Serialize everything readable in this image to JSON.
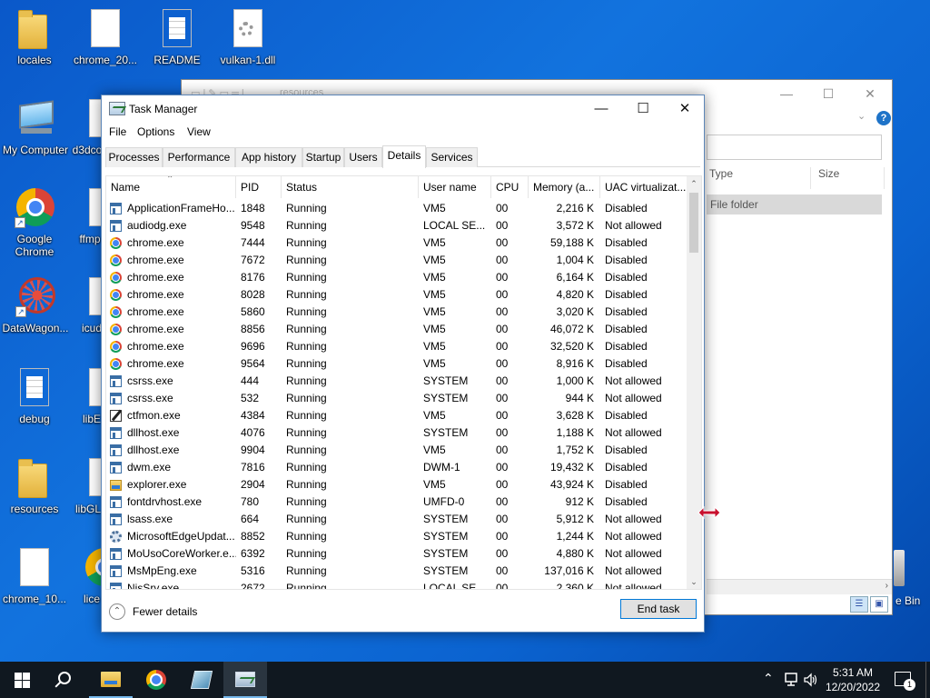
{
  "desktop": {
    "icons": [
      {
        "label": "locales",
        "icon": "folder-icon"
      },
      {
        "label": "chrome_20...",
        "icon": "file-icon"
      },
      {
        "label": "README",
        "icon": "text-file-icon"
      },
      {
        "label": "vulkan-1.dll",
        "icon": "dll-file-icon"
      },
      {
        "label": "My Computer",
        "icon": "computer-icon"
      },
      {
        "label": "d3dco",
        "icon": "dll-file-icon"
      },
      {
        "label": "Google Chrome",
        "icon": "chrome-icon"
      },
      {
        "label": "ffmp",
        "icon": "dll-file-icon"
      },
      {
        "label": "DataWagon...",
        "icon": "datawagon-icon"
      },
      {
        "label": "icud",
        "icon": "dll-file-icon"
      },
      {
        "label": "debug",
        "icon": "text-file-icon"
      },
      {
        "label": "libE",
        "icon": "dll-file-icon"
      },
      {
        "label": "resources",
        "icon": "folder-icon"
      },
      {
        "label": "libGL",
        "icon": "dll-file-icon"
      },
      {
        "label": "chrome_10...",
        "icon": "file-icon"
      },
      {
        "label": "lice",
        "icon": "chrome-icon"
      }
    ],
    "recycle_bin_label": "e Bin"
  },
  "explorer": {
    "path_ghost": "resources",
    "col_type": "Type",
    "col_size": "Size",
    "row_type": "File folder"
  },
  "task_manager": {
    "title": "Task Manager",
    "menu": [
      "File",
      "Options",
      "View"
    ],
    "tabs": [
      "Processes",
      "Performance",
      "App history",
      "Startup",
      "Users",
      "Details",
      "Services"
    ],
    "active_tab": "Details",
    "columns": [
      "Name",
      "PID",
      "Status",
      "User name",
      "CPU",
      "Memory (a...",
      "UAC virtualizat..."
    ],
    "rows": [
      {
        "icon": "app",
        "name": "ApplicationFrameHo...",
        "pid": "1848",
        "status": "Running",
        "user": "VM5",
        "cpu": "00",
        "mem": "2,216 K",
        "uac": "Disabled"
      },
      {
        "icon": "app",
        "name": "audiodg.exe",
        "pid": "9548",
        "status": "Running",
        "user": "LOCAL SE...",
        "cpu": "00",
        "mem": "3,572 K",
        "uac": "Not allowed"
      },
      {
        "icon": "chrome",
        "name": "chrome.exe",
        "pid": "7444",
        "status": "Running",
        "user": "VM5",
        "cpu": "00",
        "mem": "59,188 K",
        "uac": "Disabled"
      },
      {
        "icon": "chrome",
        "name": "chrome.exe",
        "pid": "7672",
        "status": "Running",
        "user": "VM5",
        "cpu": "00",
        "mem": "1,004 K",
        "uac": "Disabled"
      },
      {
        "icon": "chrome",
        "name": "chrome.exe",
        "pid": "8176",
        "status": "Running",
        "user": "VM5",
        "cpu": "00",
        "mem": "6,164 K",
        "uac": "Disabled"
      },
      {
        "icon": "chrome",
        "name": "chrome.exe",
        "pid": "8028",
        "status": "Running",
        "user": "VM5",
        "cpu": "00",
        "mem": "4,820 K",
        "uac": "Disabled"
      },
      {
        "icon": "chrome",
        "name": "chrome.exe",
        "pid": "5860",
        "status": "Running",
        "user": "VM5",
        "cpu": "00",
        "mem": "3,020 K",
        "uac": "Disabled"
      },
      {
        "icon": "chrome",
        "name": "chrome.exe",
        "pid": "8856",
        "status": "Running",
        "user": "VM5",
        "cpu": "00",
        "mem": "46,072 K",
        "uac": "Disabled"
      },
      {
        "icon": "chrome",
        "name": "chrome.exe",
        "pid": "9696",
        "status": "Running",
        "user": "VM5",
        "cpu": "00",
        "mem": "32,520 K",
        "uac": "Disabled"
      },
      {
        "icon": "chrome",
        "name": "chrome.exe",
        "pid": "9564",
        "status": "Running",
        "user": "VM5",
        "cpu": "00",
        "mem": "8,916 K",
        "uac": "Disabled"
      },
      {
        "icon": "app",
        "name": "csrss.exe",
        "pid": "444",
        "status": "Running",
        "user": "SYSTEM",
        "cpu": "00",
        "mem": "1,000 K",
        "uac": "Not allowed"
      },
      {
        "icon": "app",
        "name": "csrss.exe",
        "pid": "532",
        "status": "Running",
        "user": "SYSTEM",
        "cpu": "00",
        "mem": "944 K",
        "uac": "Not allowed"
      },
      {
        "icon": "pen",
        "name": "ctfmon.exe",
        "pid": "4384",
        "status": "Running",
        "user": "VM5",
        "cpu": "00",
        "mem": "3,628 K",
        "uac": "Disabled"
      },
      {
        "icon": "app",
        "name": "dllhost.exe",
        "pid": "4076",
        "status": "Running",
        "user": "SYSTEM",
        "cpu": "00",
        "mem": "1,188 K",
        "uac": "Not allowed"
      },
      {
        "icon": "app",
        "name": "dllhost.exe",
        "pid": "9904",
        "status": "Running",
        "user": "VM5",
        "cpu": "00",
        "mem": "1,752 K",
        "uac": "Disabled"
      },
      {
        "icon": "app",
        "name": "dwm.exe",
        "pid": "7816",
        "status": "Running",
        "user": "DWM-1",
        "cpu": "00",
        "mem": "19,432 K",
        "uac": "Disabled"
      },
      {
        "icon": "folder",
        "name": "explorer.exe",
        "pid": "2904",
        "status": "Running",
        "user": "VM5",
        "cpu": "00",
        "mem": "43,924 K",
        "uac": "Disabled"
      },
      {
        "icon": "app",
        "name": "fontdrvhost.exe",
        "pid": "780",
        "status": "Running",
        "user": "UMFD-0",
        "cpu": "00",
        "mem": "912 K",
        "uac": "Disabled"
      },
      {
        "icon": "app",
        "name": "lsass.exe",
        "pid": "664",
        "status": "Running",
        "user": "SYSTEM",
        "cpu": "00",
        "mem": "5,912 K",
        "uac": "Not allowed"
      },
      {
        "icon": "gear",
        "name": "MicrosoftEdgeUpdat...",
        "pid": "8852",
        "status": "Running",
        "user": "SYSTEM",
        "cpu": "00",
        "mem": "1,244 K",
        "uac": "Not allowed"
      },
      {
        "icon": "app",
        "name": "MoUsoCoreWorker.e...",
        "pid": "6392",
        "status": "Running",
        "user": "SYSTEM",
        "cpu": "00",
        "mem": "4,880 K",
        "uac": "Not allowed"
      },
      {
        "icon": "app",
        "name": "MsMpEng.exe",
        "pid": "5316",
        "status": "Running",
        "user": "SYSTEM",
        "cpu": "00",
        "mem": "137,016 K",
        "uac": "Not allowed"
      },
      {
        "icon": "app",
        "name": "NisSrv.exe",
        "pid": "2672",
        "status": "Running",
        "user": "LOCAL SE...",
        "cpu": "00",
        "mem": "2,360 K",
        "uac": "Not allowed"
      }
    ],
    "fewer_details": "Fewer details",
    "end_task": "End task"
  },
  "taskbar": {
    "time": "5:31 AM",
    "date": "12/20/2022",
    "notification_count": "1"
  }
}
